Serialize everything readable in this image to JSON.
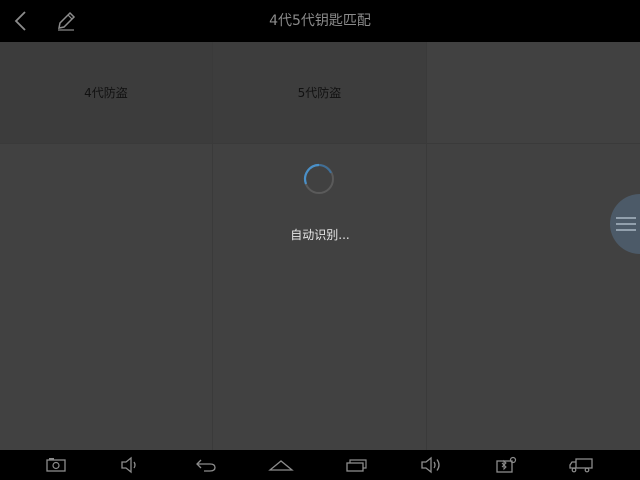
{
  "header": {
    "title": "4代5代钥匙匹配",
    "back_icon": "chevron-left-icon",
    "edit_icon": "pencil-icon"
  },
  "tiles": [
    {
      "label": "4代防盗"
    },
    {
      "label": "5代防盗"
    }
  ],
  "loading": {
    "text": "自动识别...",
    "spinner_color": "#4a90c8"
  },
  "float_menu": {
    "icon": "menu-lines-icon",
    "color": "#4c5a68"
  },
  "navbar": {
    "items": [
      {
        "icon": "screenshot-icon"
      },
      {
        "icon": "volume-down-icon"
      },
      {
        "icon": "back-arrow-icon"
      },
      {
        "icon": "home-icon"
      },
      {
        "icon": "recent-apps-icon"
      },
      {
        "icon": "volume-up-icon"
      },
      {
        "icon": "vci-connect-icon"
      },
      {
        "icon": "truck-icon"
      }
    ]
  }
}
